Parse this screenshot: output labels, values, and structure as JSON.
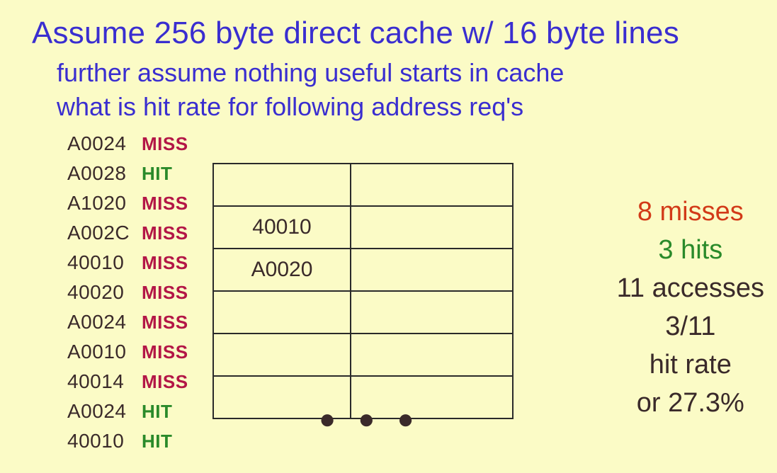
{
  "title": "Assume 256 byte direct cache w/ 16 byte lines",
  "subtitle1": "further assume nothing useful starts in cache",
  "subtitle2": "what is hit rate for following address req's",
  "accesses": [
    {
      "addr": "A0024",
      "result": "MISS"
    },
    {
      "addr": "A0028",
      "result": "HIT"
    },
    {
      "addr": "A1020",
      "result": "MISS"
    },
    {
      "addr": "A002C",
      "result": "MISS"
    },
    {
      "addr": "40010",
      "result": "MISS"
    },
    {
      "addr": "40020",
      "result": "MISS"
    },
    {
      "addr": "A0024",
      "result": "MISS"
    },
    {
      "addr": "A0010",
      "result": "MISS"
    },
    {
      "addr": "40014",
      "result": "MISS"
    },
    {
      "addr": "A0024",
      "result": "HIT"
    },
    {
      "addr": "40010",
      "result": "HIT"
    }
  ],
  "cache_table": {
    "rows": [
      {
        "col1": "",
        "col2": ""
      },
      {
        "col1": "40010",
        "col2": ""
      },
      {
        "col1": "A0020",
        "col2": ""
      },
      {
        "col1": "",
        "col2": ""
      },
      {
        "col1": "",
        "col2": ""
      },
      {
        "col1": "",
        "col2": ""
      }
    ]
  },
  "ellipsis": "● ● ●",
  "stats": {
    "misses_line": "8 misses",
    "hits_line": "3 hits",
    "accesses_line": "11 accesses",
    "ratio_line": "3/11",
    "rate_label": "hit rate",
    "percent_line": "or 27.3%"
  }
}
